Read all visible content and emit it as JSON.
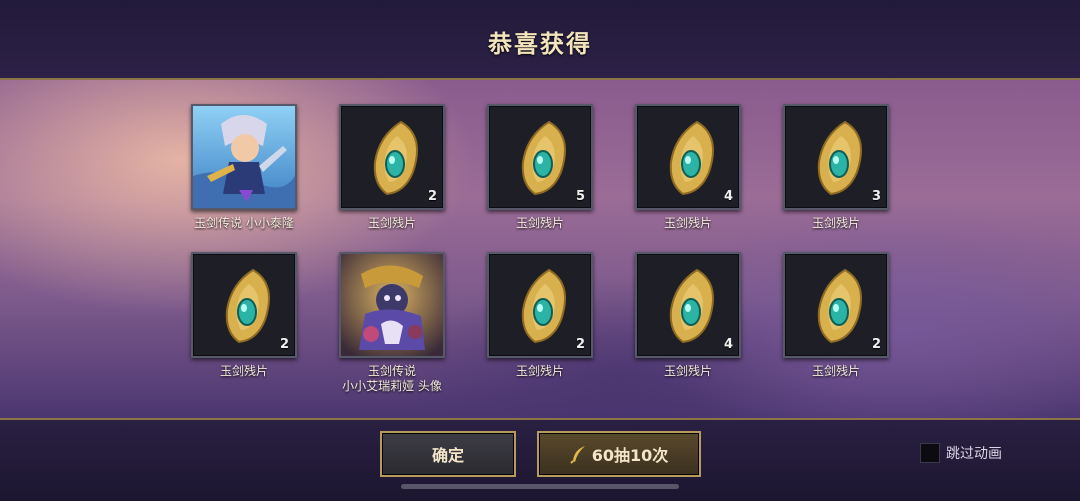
{
  "header": {
    "title": "恭喜获得"
  },
  "rewards": [
    {
      "label": "玉剑传说 小小泰隆",
      "label2": "",
      "count": "",
      "icon": "chibi-hero-portrait"
    },
    {
      "label": "玉剑残片",
      "label2": "",
      "count": "2",
      "icon": "jade-shard-icon"
    },
    {
      "label": "玉剑残片",
      "label2": "",
      "count": "5",
      "icon": "jade-shard-icon"
    },
    {
      "label": "玉剑残片",
      "label2": "",
      "count": "4",
      "icon": "jade-shard-icon"
    },
    {
      "label": "玉剑残片",
      "label2": "",
      "count": "3",
      "icon": "jade-shard-icon"
    },
    {
      "label": "玉剑残片",
      "label2": "",
      "count": "2",
      "icon": "jade-shard-icon"
    },
    {
      "label": "玉剑传说",
      "label2": "小小艾瑞莉娅 头像",
      "count": "",
      "icon": "avatar-portrait"
    },
    {
      "label": "玉剑残片",
      "label2": "",
      "count": "2",
      "icon": "jade-shard-icon"
    },
    {
      "label": "玉剑残片",
      "label2": "",
      "count": "4",
      "icon": "jade-shard-icon"
    },
    {
      "label": "玉剑残片",
      "label2": "",
      "count": "2",
      "icon": "jade-shard-icon"
    }
  ],
  "footer": {
    "confirm_label": "确定",
    "pull_label": "60抽10次",
    "pull_icon": "feather-icon",
    "skip_label": "跳过动画",
    "skip_checked": false
  },
  "colors": {
    "accent_gold": "#b89b5a",
    "title_text": "#f3e4bd"
  }
}
